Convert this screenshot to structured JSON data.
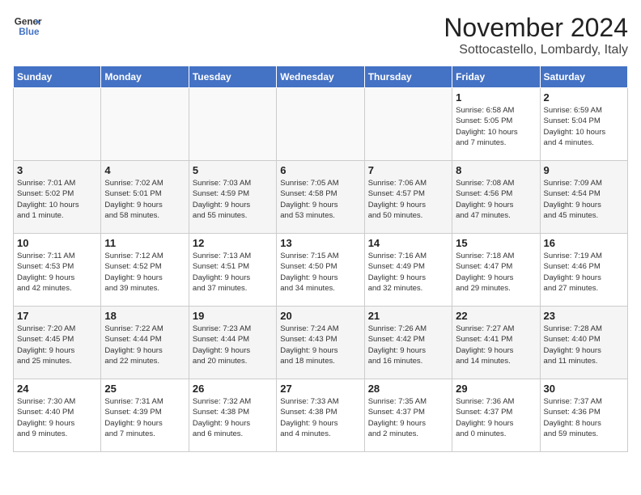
{
  "logo": {
    "line1": "General",
    "line2": "Blue"
  },
  "title": "November 2024",
  "location": "Sottocastello, Lombardy, Italy",
  "headers": [
    "Sunday",
    "Monday",
    "Tuesday",
    "Wednesday",
    "Thursday",
    "Friday",
    "Saturday"
  ],
  "weeks": [
    [
      {
        "day": "",
        "info": ""
      },
      {
        "day": "",
        "info": ""
      },
      {
        "day": "",
        "info": ""
      },
      {
        "day": "",
        "info": ""
      },
      {
        "day": "",
        "info": ""
      },
      {
        "day": "1",
        "info": "Sunrise: 6:58 AM\nSunset: 5:05 PM\nDaylight: 10 hours\nand 7 minutes."
      },
      {
        "day": "2",
        "info": "Sunrise: 6:59 AM\nSunset: 5:04 PM\nDaylight: 10 hours\nand 4 minutes."
      }
    ],
    [
      {
        "day": "3",
        "info": "Sunrise: 7:01 AM\nSunset: 5:02 PM\nDaylight: 10 hours\nand 1 minute."
      },
      {
        "day": "4",
        "info": "Sunrise: 7:02 AM\nSunset: 5:01 PM\nDaylight: 9 hours\nand 58 minutes."
      },
      {
        "day": "5",
        "info": "Sunrise: 7:03 AM\nSunset: 4:59 PM\nDaylight: 9 hours\nand 55 minutes."
      },
      {
        "day": "6",
        "info": "Sunrise: 7:05 AM\nSunset: 4:58 PM\nDaylight: 9 hours\nand 53 minutes."
      },
      {
        "day": "7",
        "info": "Sunrise: 7:06 AM\nSunset: 4:57 PM\nDaylight: 9 hours\nand 50 minutes."
      },
      {
        "day": "8",
        "info": "Sunrise: 7:08 AM\nSunset: 4:56 PM\nDaylight: 9 hours\nand 47 minutes."
      },
      {
        "day": "9",
        "info": "Sunrise: 7:09 AM\nSunset: 4:54 PM\nDaylight: 9 hours\nand 45 minutes."
      }
    ],
    [
      {
        "day": "10",
        "info": "Sunrise: 7:11 AM\nSunset: 4:53 PM\nDaylight: 9 hours\nand 42 minutes."
      },
      {
        "day": "11",
        "info": "Sunrise: 7:12 AM\nSunset: 4:52 PM\nDaylight: 9 hours\nand 39 minutes."
      },
      {
        "day": "12",
        "info": "Sunrise: 7:13 AM\nSunset: 4:51 PM\nDaylight: 9 hours\nand 37 minutes."
      },
      {
        "day": "13",
        "info": "Sunrise: 7:15 AM\nSunset: 4:50 PM\nDaylight: 9 hours\nand 34 minutes."
      },
      {
        "day": "14",
        "info": "Sunrise: 7:16 AM\nSunset: 4:49 PM\nDaylight: 9 hours\nand 32 minutes."
      },
      {
        "day": "15",
        "info": "Sunrise: 7:18 AM\nSunset: 4:47 PM\nDaylight: 9 hours\nand 29 minutes."
      },
      {
        "day": "16",
        "info": "Sunrise: 7:19 AM\nSunset: 4:46 PM\nDaylight: 9 hours\nand 27 minutes."
      }
    ],
    [
      {
        "day": "17",
        "info": "Sunrise: 7:20 AM\nSunset: 4:45 PM\nDaylight: 9 hours\nand 25 minutes."
      },
      {
        "day": "18",
        "info": "Sunrise: 7:22 AM\nSunset: 4:44 PM\nDaylight: 9 hours\nand 22 minutes."
      },
      {
        "day": "19",
        "info": "Sunrise: 7:23 AM\nSunset: 4:44 PM\nDaylight: 9 hours\nand 20 minutes."
      },
      {
        "day": "20",
        "info": "Sunrise: 7:24 AM\nSunset: 4:43 PM\nDaylight: 9 hours\nand 18 minutes."
      },
      {
        "day": "21",
        "info": "Sunrise: 7:26 AM\nSunset: 4:42 PM\nDaylight: 9 hours\nand 16 minutes."
      },
      {
        "day": "22",
        "info": "Sunrise: 7:27 AM\nSunset: 4:41 PM\nDaylight: 9 hours\nand 14 minutes."
      },
      {
        "day": "23",
        "info": "Sunrise: 7:28 AM\nSunset: 4:40 PM\nDaylight: 9 hours\nand 11 minutes."
      }
    ],
    [
      {
        "day": "24",
        "info": "Sunrise: 7:30 AM\nSunset: 4:40 PM\nDaylight: 9 hours\nand 9 minutes."
      },
      {
        "day": "25",
        "info": "Sunrise: 7:31 AM\nSunset: 4:39 PM\nDaylight: 9 hours\nand 7 minutes."
      },
      {
        "day": "26",
        "info": "Sunrise: 7:32 AM\nSunset: 4:38 PM\nDaylight: 9 hours\nand 6 minutes."
      },
      {
        "day": "27",
        "info": "Sunrise: 7:33 AM\nSunset: 4:38 PM\nDaylight: 9 hours\nand 4 minutes."
      },
      {
        "day": "28",
        "info": "Sunrise: 7:35 AM\nSunset: 4:37 PM\nDaylight: 9 hours\nand 2 minutes."
      },
      {
        "day": "29",
        "info": "Sunrise: 7:36 AM\nSunset: 4:37 PM\nDaylight: 9 hours\nand 0 minutes."
      },
      {
        "day": "30",
        "info": "Sunrise: 7:37 AM\nSunset: 4:36 PM\nDaylight: 8 hours\nand 59 minutes."
      }
    ]
  ]
}
